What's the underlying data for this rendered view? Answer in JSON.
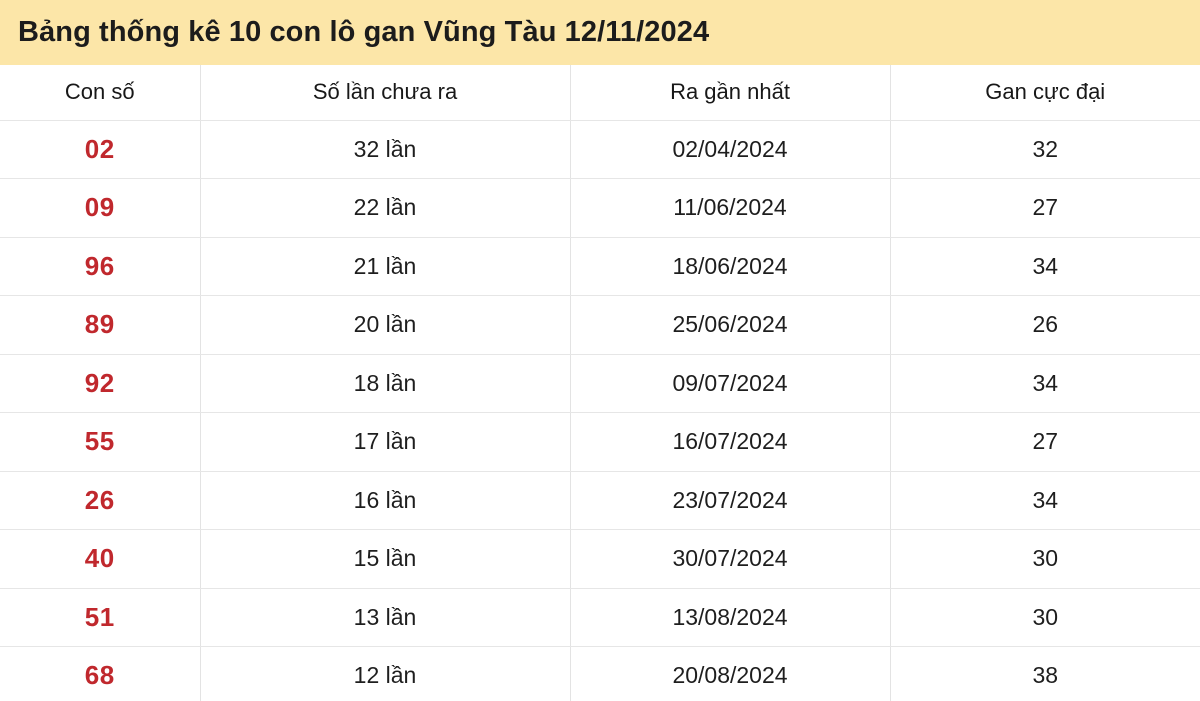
{
  "header": {
    "title": "Bảng thống kê 10 con lô gan Vũng Tàu 12/11/2024",
    "background_color": "#fce6a8"
  },
  "table": {
    "columns": [
      {
        "key": "number",
        "label": "Con số"
      },
      {
        "key": "times",
        "label": "Số lần chưa ra"
      },
      {
        "key": "last",
        "label": "Ra gần nhất"
      },
      {
        "key": "maxgan",
        "label": "Gan cực đại"
      }
    ],
    "accent_number_color": "#c0282d",
    "rows": [
      {
        "number": "02",
        "times": "32 lần",
        "last": "02/04/2024",
        "maxgan": "32"
      },
      {
        "number": "09",
        "times": "22 lần",
        "last": "11/06/2024",
        "maxgan": "27"
      },
      {
        "number": "96",
        "times": "21 lần",
        "last": "18/06/2024",
        "maxgan": "34"
      },
      {
        "number": "89",
        "times": "20 lần",
        "last": "25/06/2024",
        "maxgan": "26"
      },
      {
        "number": "92",
        "times": "18 lần",
        "last": "09/07/2024",
        "maxgan": "34"
      },
      {
        "number": "55",
        "times": "17 lần",
        "last": "16/07/2024",
        "maxgan": "27"
      },
      {
        "number": "26",
        "times": "16 lần",
        "last": "23/07/2024",
        "maxgan": "34"
      },
      {
        "number": "40",
        "times": "15 lần",
        "last": "30/07/2024",
        "maxgan": "30"
      },
      {
        "number": "51",
        "times": "13 lần",
        "last": "13/08/2024",
        "maxgan": "30"
      },
      {
        "number": "68",
        "times": "12 lần",
        "last": "20/08/2024",
        "maxgan": "38"
      }
    ]
  }
}
